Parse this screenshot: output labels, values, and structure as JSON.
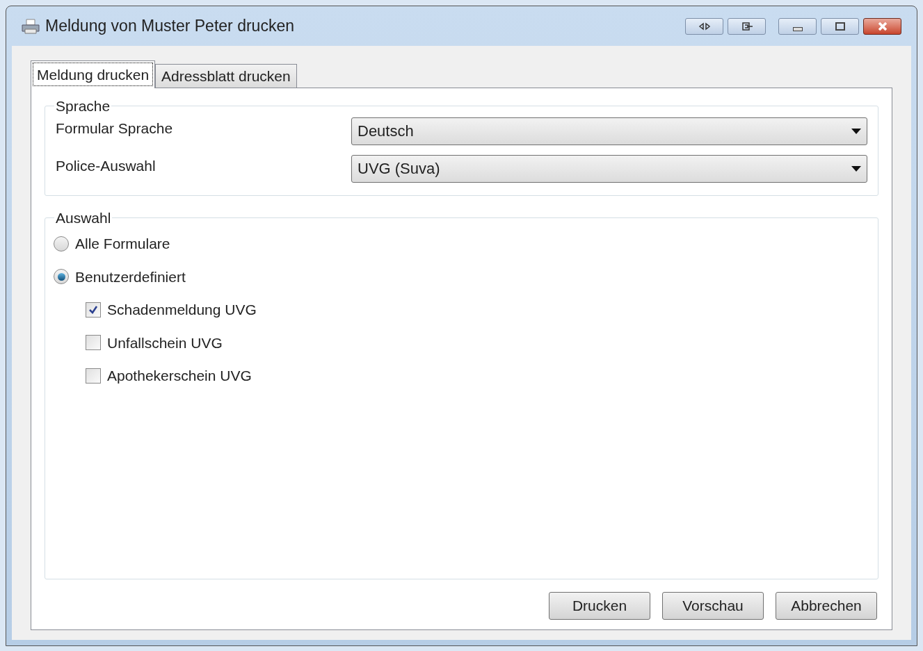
{
  "window": {
    "title": "Meldung von Muster Peter drucken"
  },
  "tabs": [
    {
      "label": "Meldung drucken",
      "selected": true
    },
    {
      "label": "Adressblatt drucken",
      "selected": false
    }
  ],
  "sprache": {
    "title": "Sprache",
    "fields": [
      {
        "label": "Formular Sprache",
        "value": "Deutsch"
      },
      {
        "label": "Police-Auswahl",
        "value": "UVG (Suva)"
      }
    ]
  },
  "auswahl": {
    "title": "Auswahl",
    "options": [
      {
        "label": "Alle Formulare",
        "selected": false
      },
      {
        "label": "Benutzerdefiniert",
        "selected": true,
        "children": [
          {
            "label": "Schadenmeldung UVG",
            "checked": true
          },
          {
            "label": "Unfallschein UVG",
            "checked": false
          },
          {
            "label": "Apothekerschein UVG",
            "checked": false
          }
        ]
      }
    ]
  },
  "buttons": [
    "Drucken",
    "Vorschau",
    "Abbrechen"
  ]
}
